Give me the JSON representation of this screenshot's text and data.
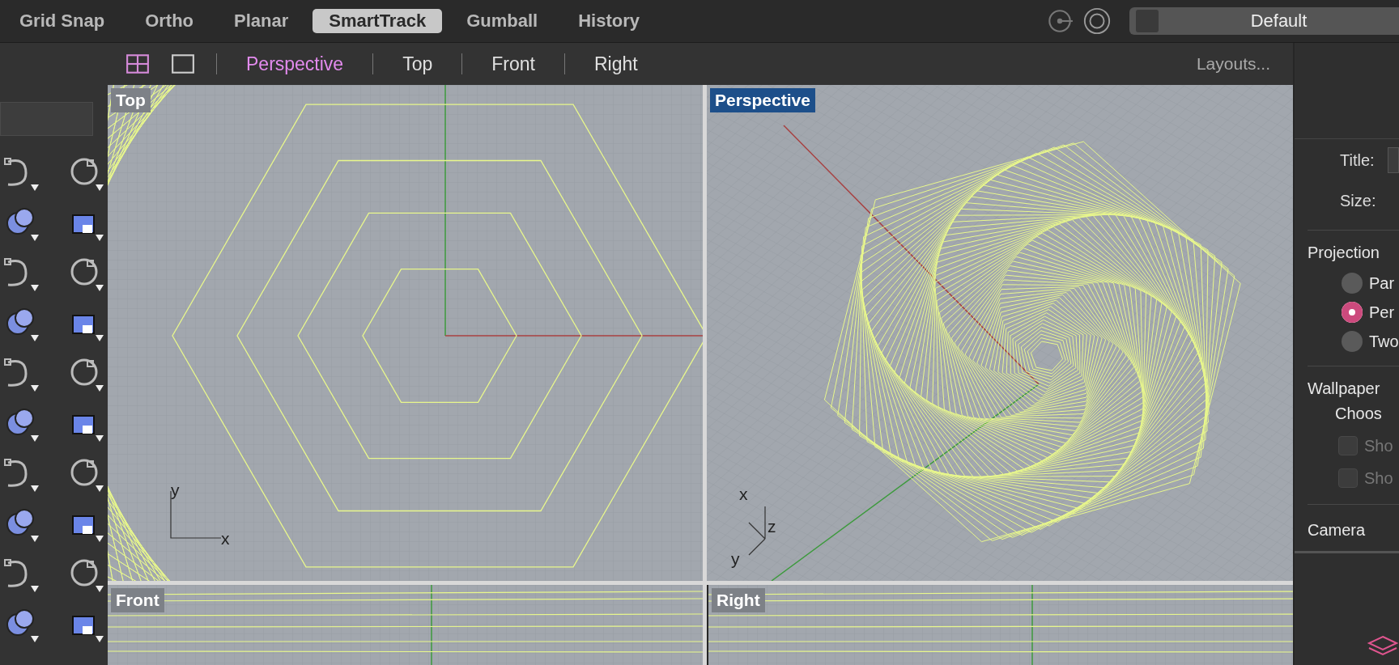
{
  "toolbar": {
    "toggles": [
      {
        "label": "Grid Snap",
        "selected": false
      },
      {
        "label": "Ortho",
        "selected": false
      },
      {
        "label": "Planar",
        "selected": false
      },
      {
        "label": "SmartTrack",
        "selected": true
      },
      {
        "label": "Gumball",
        "selected": false
      },
      {
        "label": "History",
        "selected": false
      }
    ],
    "display_mode": "Default"
  },
  "viewport_tabs": {
    "tabs": [
      {
        "label": "Perspective",
        "selected": true
      },
      {
        "label": "Top",
        "selected": false
      },
      {
        "label": "Front",
        "selected": false
      },
      {
        "label": "Right",
        "selected": false
      }
    ],
    "layouts": "Layouts..."
  },
  "viewports": [
    {
      "title": "Top",
      "kind": "top",
      "active": false,
      "axis_labels": [
        "y",
        "x"
      ]
    },
    {
      "title": "Perspective",
      "kind": "perspective",
      "active": true,
      "axis_labels": [
        "x",
        "z",
        "y"
      ]
    },
    {
      "title": "Front",
      "kind": "front",
      "active": false
    },
    {
      "title": "Right",
      "kind": "right",
      "active": false
    }
  ],
  "panel": {
    "title_label": "Title:",
    "size_label": "Size:",
    "projection": {
      "heading": "Projection",
      "options": [
        {
          "label": "Par",
          "selected": false
        },
        {
          "label": "Per",
          "selected": true
        },
        {
          "label": "Two",
          "selected": false
        }
      ]
    },
    "wallpaper": {
      "heading": "Wallpaper",
      "choose": "Choos",
      "checkboxes": [
        {
          "label": "Sho",
          "checked": false,
          "disabled": true
        },
        {
          "label": "Sho",
          "checked": false,
          "disabled": true
        }
      ]
    },
    "camera": "Camera"
  }
}
